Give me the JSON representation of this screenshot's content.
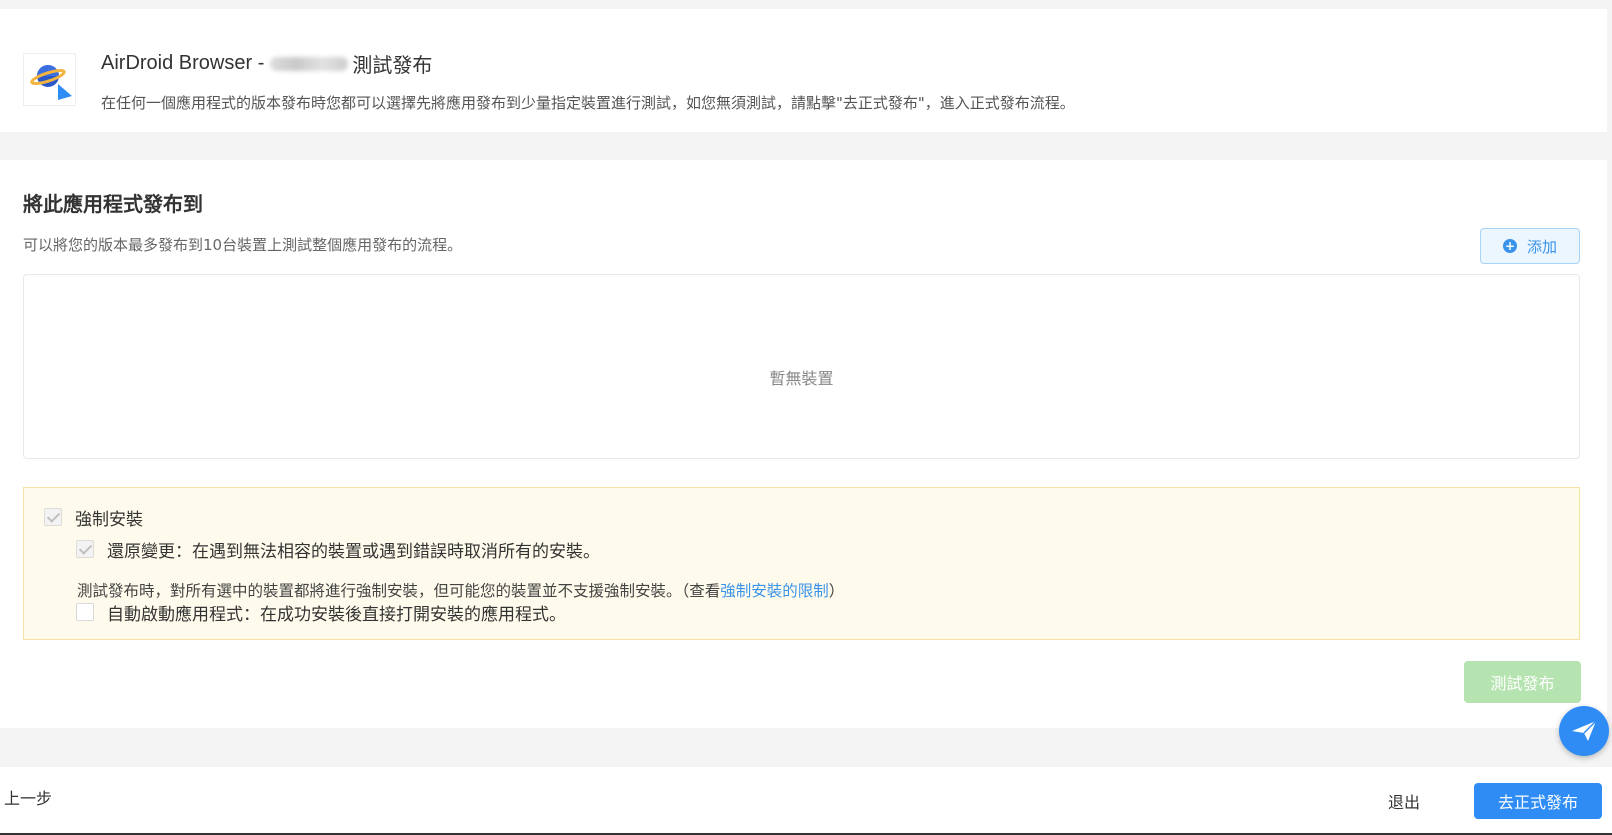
{
  "header": {
    "app_name": "AirDroid Browser -",
    "title_suffix": "測試發布",
    "description": "在任何一個應用程式的版本發布時您都可以選擇先將應用發布到少量指定裝置進行測試，如您無須測試，請點擊\"去正式發布\"，進入正式發布流程。"
  },
  "section": {
    "title": "將此應用程式發布到",
    "description": "可以將您的版本最多發布到10台裝置上測試整個應用發布的流程。",
    "add_label": "添加",
    "empty_text": "暫無裝置"
  },
  "options": {
    "force_install_label": "強制安裝",
    "force_install_checked": true,
    "revert_label": "還原變更：在遇到無法相容的裝置或遇到錯誤時取消所有的安裝。",
    "revert_checked": true,
    "note_prefix": "測試發布時，對所有選中的裝置都將進行強制安裝，但可能您的裝置並不支援強制安裝。（查看",
    "note_link": "強制安裝的限制",
    "note_suffix": "）",
    "auto_launch_label": "自動啟動應用程式：在成功安裝後直接打開安裝的應用程式。",
    "auto_launch_checked": false
  },
  "actions": {
    "test_publish_label": "測試發布"
  },
  "footer": {
    "prev_label": "上一步",
    "exit_label": "退出",
    "publish_label": "去正式發布"
  },
  "colors": {
    "accent": "#2f8cf5",
    "success_disabled": "#b6e4b0",
    "warning_bg": "#fffbec"
  }
}
